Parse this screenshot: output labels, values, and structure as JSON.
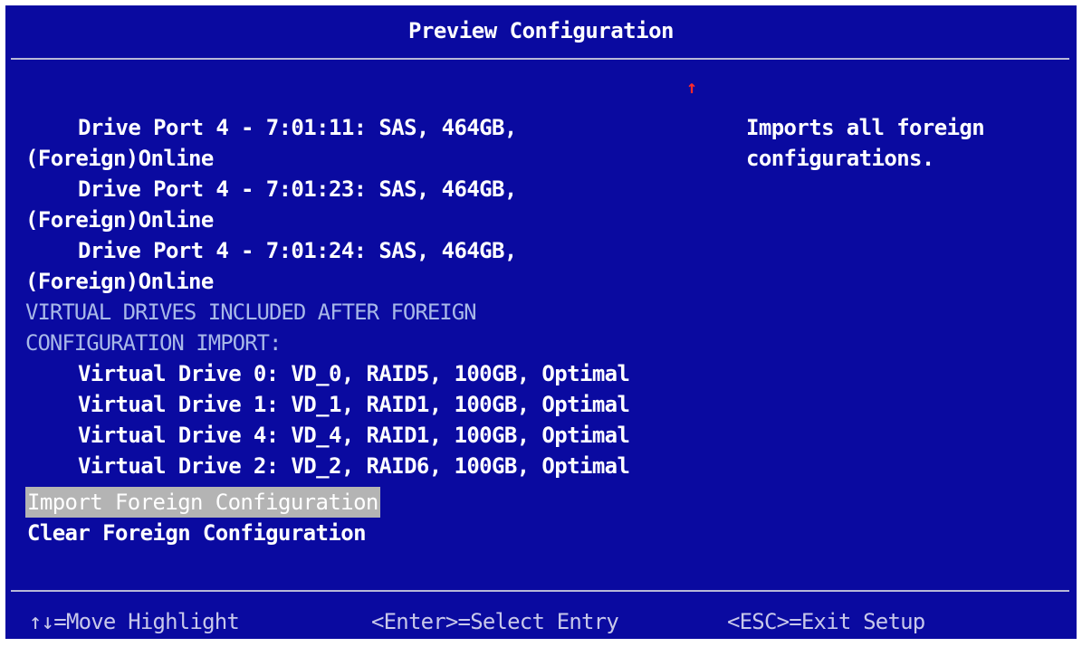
{
  "window": {
    "title": "Preview Configuration"
  },
  "scroll_indicator": "↑",
  "content": {
    "drives": [
      {
        "line1": "Drive Port 4 - 7:01:11: SAS, 464GB,",
        "line2": "(Foreign)Online"
      },
      {
        "line1": "Drive Port 4 - 7:01:23: SAS, 464GB,",
        "line2": "(Foreign)Online"
      },
      {
        "line1": "Drive Port 4 - 7:01:24: SAS, 464GB,",
        "line2": "(Foreign)Online"
      }
    ],
    "heading_line1": "VIRTUAL DRIVES INCLUDED AFTER FOREIGN",
    "heading_line2": "CONFIGURATION IMPORT:",
    "virtual_drives": [
      "Virtual Drive 0: VD_0, RAID5, 100GB, Optimal",
      "Virtual Drive 1: VD_1, RAID1, 100GB, Optimal",
      "Virtual Drive 4: VD_4, RAID1, 100GB, Optimal",
      "Virtual Drive 2: VD_2, RAID6, 100GB, Optimal"
    ]
  },
  "menu": {
    "import_label": "Import Foreign Configuration",
    "clear_label": "Clear Foreign Configuration",
    "selected": "Import Foreign Configuration"
  },
  "help": {
    "line1": "Imports all foreign",
    "line2": "configurations."
  },
  "footer": {
    "move": "↑↓=Move Highlight",
    "select": "<Enter>=Select Entry",
    "exit": "<ESC>=Exit Setup"
  },
  "colors": {
    "background": "#0a0aa0",
    "highlight": "#b4b4b4",
    "heading_text": "#a8b8e8",
    "scroll_arrow": "#ff2a2a"
  }
}
